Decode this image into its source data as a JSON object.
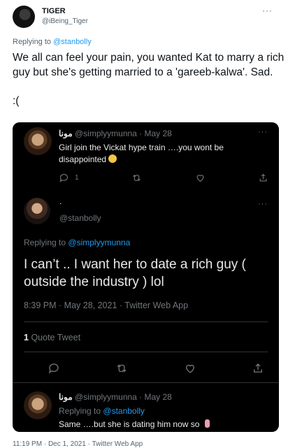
{
  "outer_tweet": {
    "name": "TIGER",
    "handle": "@iBeing_Tiger",
    "more_icon": "···",
    "replying_prefix": "Replying to",
    "replying_to": "@stanbolly",
    "text_line1": "We all can feel your pain, you wanted Kat to marry a rich guy but she's getting married to a 'gareeb-kalwa'. Sad.",
    "text_line2": ":(",
    "meta": "11:19 PM · Dec 1, 2021 · Twitter Web App"
  },
  "quoted_thread": {
    "tweet1": {
      "name": "مونا",
      "handle_time": "@simplyymunna · May 28",
      "text": "Girl join the Vickat hype train ….you wont be disappointed",
      "reply_count": "1",
      "more_icon": "···"
    },
    "tweet2": {
      "name": ".",
      "handle": "@stanbolly",
      "replying_prefix": "Replying to",
      "replying_to": "@simplyymunna",
      "text": "I can’t .. I want her to date a rich guy ( outside the industry )  lol",
      "meta": "8:39 PM · May 28, 2021 · Twitter Web App",
      "quote_count": "1",
      "quote_label": "Quote Tweet",
      "more_icon": "···"
    },
    "tweet3": {
      "name": "مونا",
      "handle_time": "@simplyymunna · May 28",
      "replying_prefix": "Replying to",
      "replying_to": "@stanbolly",
      "text": "Same ….but she is dating him now so"
    }
  },
  "colors": {
    "accent": "#1d9bf0",
    "dark_bg": "#000000",
    "muted": "#71767b"
  }
}
